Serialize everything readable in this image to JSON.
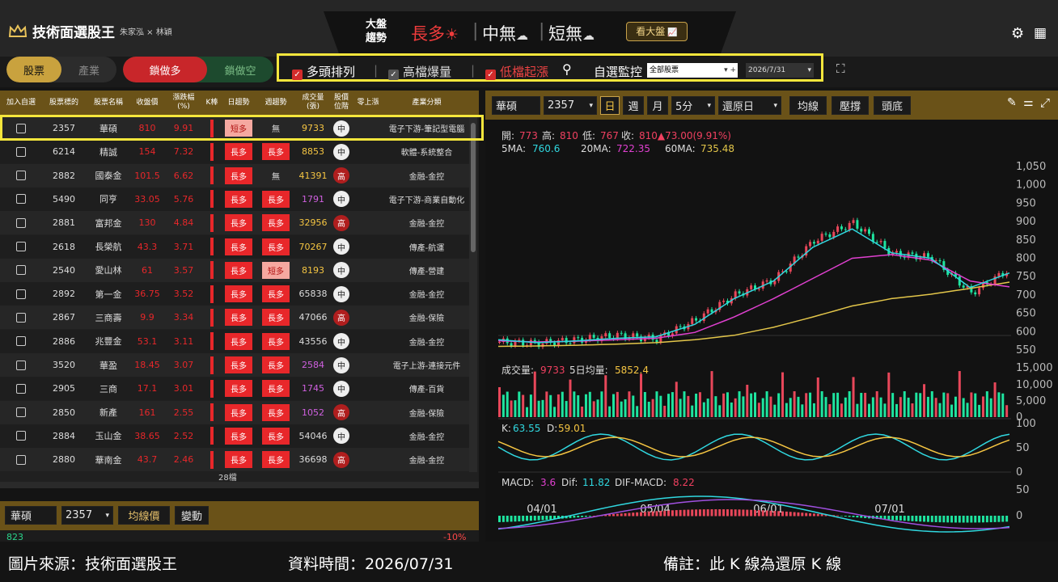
{
  "header": {
    "app_name": "技術面選股王",
    "credit": "朱家泓 × 林穎",
    "dapan_line1": "大盤",
    "dapan_line2": "趨勢",
    "trend_long": "長多",
    "trend_mid": "中無",
    "trend_short": "短無",
    "watch_button": "看大盤"
  },
  "tabs": {
    "stocks": "股票",
    "industry": "產業",
    "lock_long": "鎖做多",
    "lock_short": "鎖做空"
  },
  "filters": {
    "f1_label": "多頭排列",
    "f1_checked": true,
    "f2_label": "高檔爆量",
    "f2_checked": false,
    "f3_label": "低檔起漲",
    "f3_checked": true,
    "watch_label": "自選監控",
    "watch_value": "全部股票",
    "date_value": "2026/7/31"
  },
  "table": {
    "headers": [
      "加入自選",
      "股票標的",
      "股票名稱",
      "收盤價",
      "漲跌幅\n(%)",
      "K棒",
      "日趨勢",
      "週趨勢",
      "成交量\n(張)",
      "股價\n位階",
      "零上漲",
      "產業分類"
    ],
    "rows": [
      {
        "code": "2357",
        "name": "華碩",
        "price": "810",
        "chg": "9.91",
        "day": "短多",
        "week": "無",
        "vol": "9733",
        "pos": "中",
        "ind": "電子下游-筆記型電腦"
      },
      {
        "code": "6214",
        "name": "精誠",
        "price": "154",
        "chg": "7.32",
        "day": "長多",
        "week": "長多",
        "vol": "8853",
        "pos": "中",
        "ind": "軟體-系統整合"
      },
      {
        "code": "2882",
        "name": "國泰金",
        "price": "101.5",
        "chg": "6.62",
        "day": "長多",
        "week": "無",
        "vol": "41391",
        "pos": "高",
        "ind": "金融-金控"
      },
      {
        "code": "5490",
        "name": "同亨",
        "price": "33.05",
        "chg": "5.76",
        "day": "長多",
        "week": "長多",
        "vol": "1791",
        "pos": "中",
        "ind": "電子下游-商業自動化"
      },
      {
        "code": "2881",
        "name": "富邦金",
        "price": "130",
        "chg": "4.84",
        "day": "長多",
        "week": "長多",
        "vol": "32956",
        "pos": "高",
        "ind": "金融-金控"
      },
      {
        "code": "2618",
        "name": "長榮航",
        "price": "43.3",
        "chg": "3.71",
        "day": "長多",
        "week": "長多",
        "vol": "70267",
        "pos": "中",
        "ind": "傳產-航運"
      },
      {
        "code": "2540",
        "name": "愛山林",
        "price": "61",
        "chg": "3.57",
        "day": "長多",
        "week": "短多",
        "vol": "8193",
        "pos": "中",
        "ind": "傳產-營建"
      },
      {
        "code": "2892",
        "name": "第一金",
        "price": "36.75",
        "chg": "3.52",
        "day": "長多",
        "week": "長多",
        "vol": "65838",
        "pos": "中",
        "ind": "金融-金控"
      },
      {
        "code": "2867",
        "name": "三商壽",
        "price": "9.9",
        "chg": "3.34",
        "day": "長多",
        "week": "長多",
        "vol": "47066",
        "pos": "高",
        "ind": "金融-保險"
      },
      {
        "code": "2886",
        "name": "兆豐金",
        "price": "53.1",
        "chg": "3.11",
        "day": "長多",
        "week": "長多",
        "vol": "43556",
        "pos": "中",
        "ind": "金融-金控"
      },
      {
        "code": "3520",
        "name": "華盈",
        "price": "18.45",
        "chg": "3.07",
        "day": "長多",
        "week": "長多",
        "vol": "2584",
        "pos": "中",
        "ind": "電子上游-連接元件"
      },
      {
        "code": "2905",
        "name": "三商",
        "price": "17.1",
        "chg": "3.01",
        "day": "長多",
        "week": "長多",
        "vol": "1745",
        "pos": "中",
        "ind": "傳產-百貨"
      },
      {
        "code": "2850",
        "name": "新產",
        "price": "161",
        "chg": "2.55",
        "day": "長多",
        "week": "長多",
        "vol": "1052",
        "pos": "高",
        "ind": "金融-保險"
      },
      {
        "code": "2884",
        "name": "玉山金",
        "price": "38.65",
        "chg": "2.52",
        "day": "長多",
        "week": "長多",
        "vol": "54046",
        "pos": "中",
        "ind": "金融-金控"
      },
      {
        "code": "2880",
        "name": "華南金",
        "price": "43.7",
        "chg": "2.46",
        "day": "長多",
        "week": "長多",
        "vol": "36698",
        "pos": "高",
        "ind": "金融-金控"
      }
    ],
    "count": "28檔"
  },
  "bottom": {
    "name": "華碩",
    "code": "2357",
    "btn_ma": "均線價",
    "btn_change": "變動",
    "pct": "-10%",
    "cut": "823"
  },
  "chart_toolbar": {
    "name": "華碩",
    "code": "2357",
    "day": "日",
    "week": "週",
    "month": "月",
    "min": "5分",
    "restore": "還原日",
    "ma": "均線",
    "sr": "壓撐",
    "top": "頭底"
  },
  "chart_data": {
    "type": "line",
    "info": {
      "open_l": "開:",
      "open": "773",
      "high_l": "高:",
      "high": "810",
      "low_l": "低:",
      "low": "767",
      "close_l": "收:",
      "close": "810▲73.00(9.91%)",
      "ma5_l": "5MA:",
      "ma5": "760.6",
      "ma20_l": "20MA:",
      "ma20": "722.35",
      "ma60_l": "60MA:",
      "ma60": "735.48"
    },
    "y_ticks": [
      "1,050",
      "1,000",
      "950",
      "900",
      "850",
      "800",
      "750",
      "700",
      "650",
      "600",
      "550"
    ],
    "x_ticks": [
      "04/01",
      "05/04",
      "06/01",
      "07/01"
    ],
    "volume": {
      "label": "成交量:",
      "value": "9733",
      "avg_label": "5日均量:",
      "avg": "5852.4",
      "ticks": [
        "15,000",
        "10,000",
        "5,000",
        "0"
      ]
    },
    "kd": {
      "k_label": "K:",
      "k": "63.55",
      "d_label": "D:",
      "d": "59.01",
      "ticks": [
        "100",
        "50",
        "0"
      ]
    },
    "macd": {
      "label": "MACD:",
      "value": "3.6",
      "dif_label": "Dif:",
      "dif": "11.82",
      "osc_label": "DIF-MACD:",
      "osc": "8.22",
      "ticks": [
        "50",
        "0"
      ]
    },
    "price_x": [
      0,
      10,
      20,
      30,
      40,
      50,
      60,
      70,
      80,
      90,
      100,
      110,
      120,
      130
    ],
    "close": [
      572,
      568,
      578,
      590,
      580,
      632,
      700,
      742,
      848,
      896,
      812,
      802,
      705,
      772
    ],
    "ma5": [
      578,
      570,
      575,
      582,
      586,
      620,
      690,
      738,
      830,
      880,
      815,
      800,
      720,
      760
    ],
    "ma20": [
      575,
      572,
      574,
      578,
      582,
      598,
      640,
      690,
      745,
      800,
      810,
      795,
      738,
      722
    ],
    "ma60": [
      560,
      561,
      563,
      566,
      570,
      578,
      590,
      612,
      640,
      670,
      690,
      702,
      718,
      735
    ]
  },
  "footer": {
    "source": "圖片來源：技術面選股王",
    "data_time": "資料時間：2026/07/31",
    "note": "備註：此 K 線為還原 K 線"
  },
  "colors": {
    "gold": "#6a5218",
    "red": "#e8272a",
    "green": "#1ee5a0",
    "highlight": "#f5e63c"
  }
}
